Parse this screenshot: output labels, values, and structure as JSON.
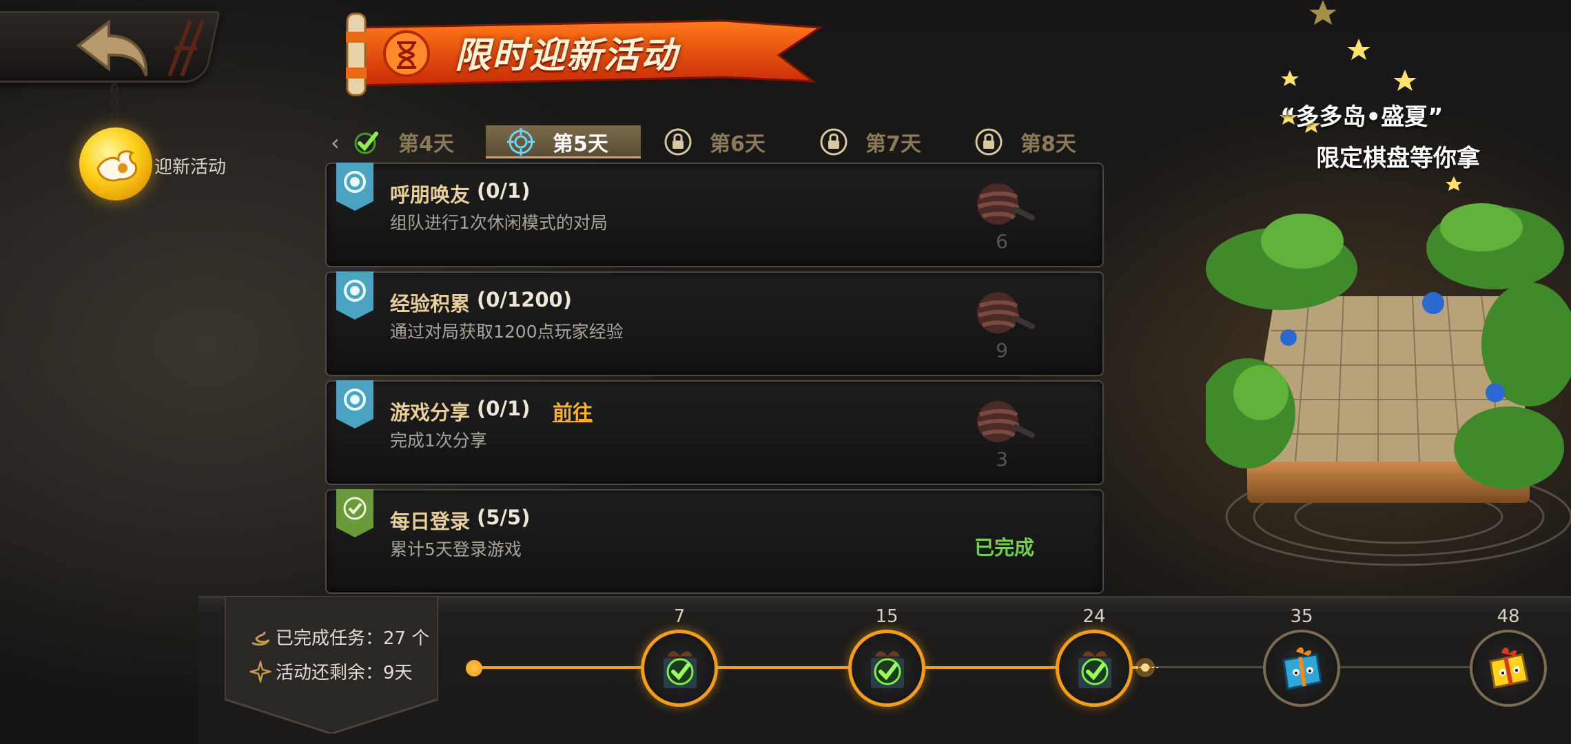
{
  "header": {
    "title": "限时迎新活动",
    "side_label": "迎新活动"
  },
  "tabs": [
    {
      "label": "第4天",
      "state": "completed",
      "icon": "check-icon"
    },
    {
      "label": "第5天",
      "state": "active",
      "icon": "target-icon"
    },
    {
      "label": "第6天",
      "state": "locked",
      "icon": "lock-icon"
    },
    {
      "label": "第7天",
      "state": "locked",
      "icon": "lock-icon"
    },
    {
      "label": "第8天",
      "state": "locked",
      "icon": "lock-icon"
    }
  ],
  "tasks": [
    {
      "title": "呼朋唤友",
      "progress": "(0/1)",
      "desc": "组队进行1次休闲模式的对局",
      "reward_count": "6",
      "status": "in-progress"
    },
    {
      "title": "经验积累",
      "progress": "(0/1200)",
      "desc": "通过对局获取1200点玩家经验",
      "reward_count": "9",
      "status": "in-progress"
    },
    {
      "title": "游戏分享",
      "progress": "(0/1)",
      "desc": "完成1次分享",
      "go_label": "前往",
      "reward_count": "3",
      "status": "in-progress"
    },
    {
      "title": "每日登录",
      "progress": "(5/5)",
      "desc": "累计5天登录游戏",
      "done_label": "已完成",
      "status": "completed"
    }
  ],
  "stats": {
    "completed_tasks": "已完成任务：27 个",
    "days_remaining": "活动还剩余：9天"
  },
  "milestones": [
    {
      "value": "7",
      "claimed": true
    },
    {
      "value": "15",
      "claimed": true
    },
    {
      "value": "24",
      "claimed": true
    },
    {
      "value": "35",
      "claimed": false
    },
    {
      "value": "48",
      "claimed": false
    }
  ],
  "promo": {
    "line1": "“多多岛•盛夏”",
    "line2": "限定棋盘等你拿"
  },
  "colors": {
    "accent": "#f59d15",
    "done_green": "#72d04c",
    "go_link": "#ffb21e",
    "banner_red": "#e0410b"
  }
}
